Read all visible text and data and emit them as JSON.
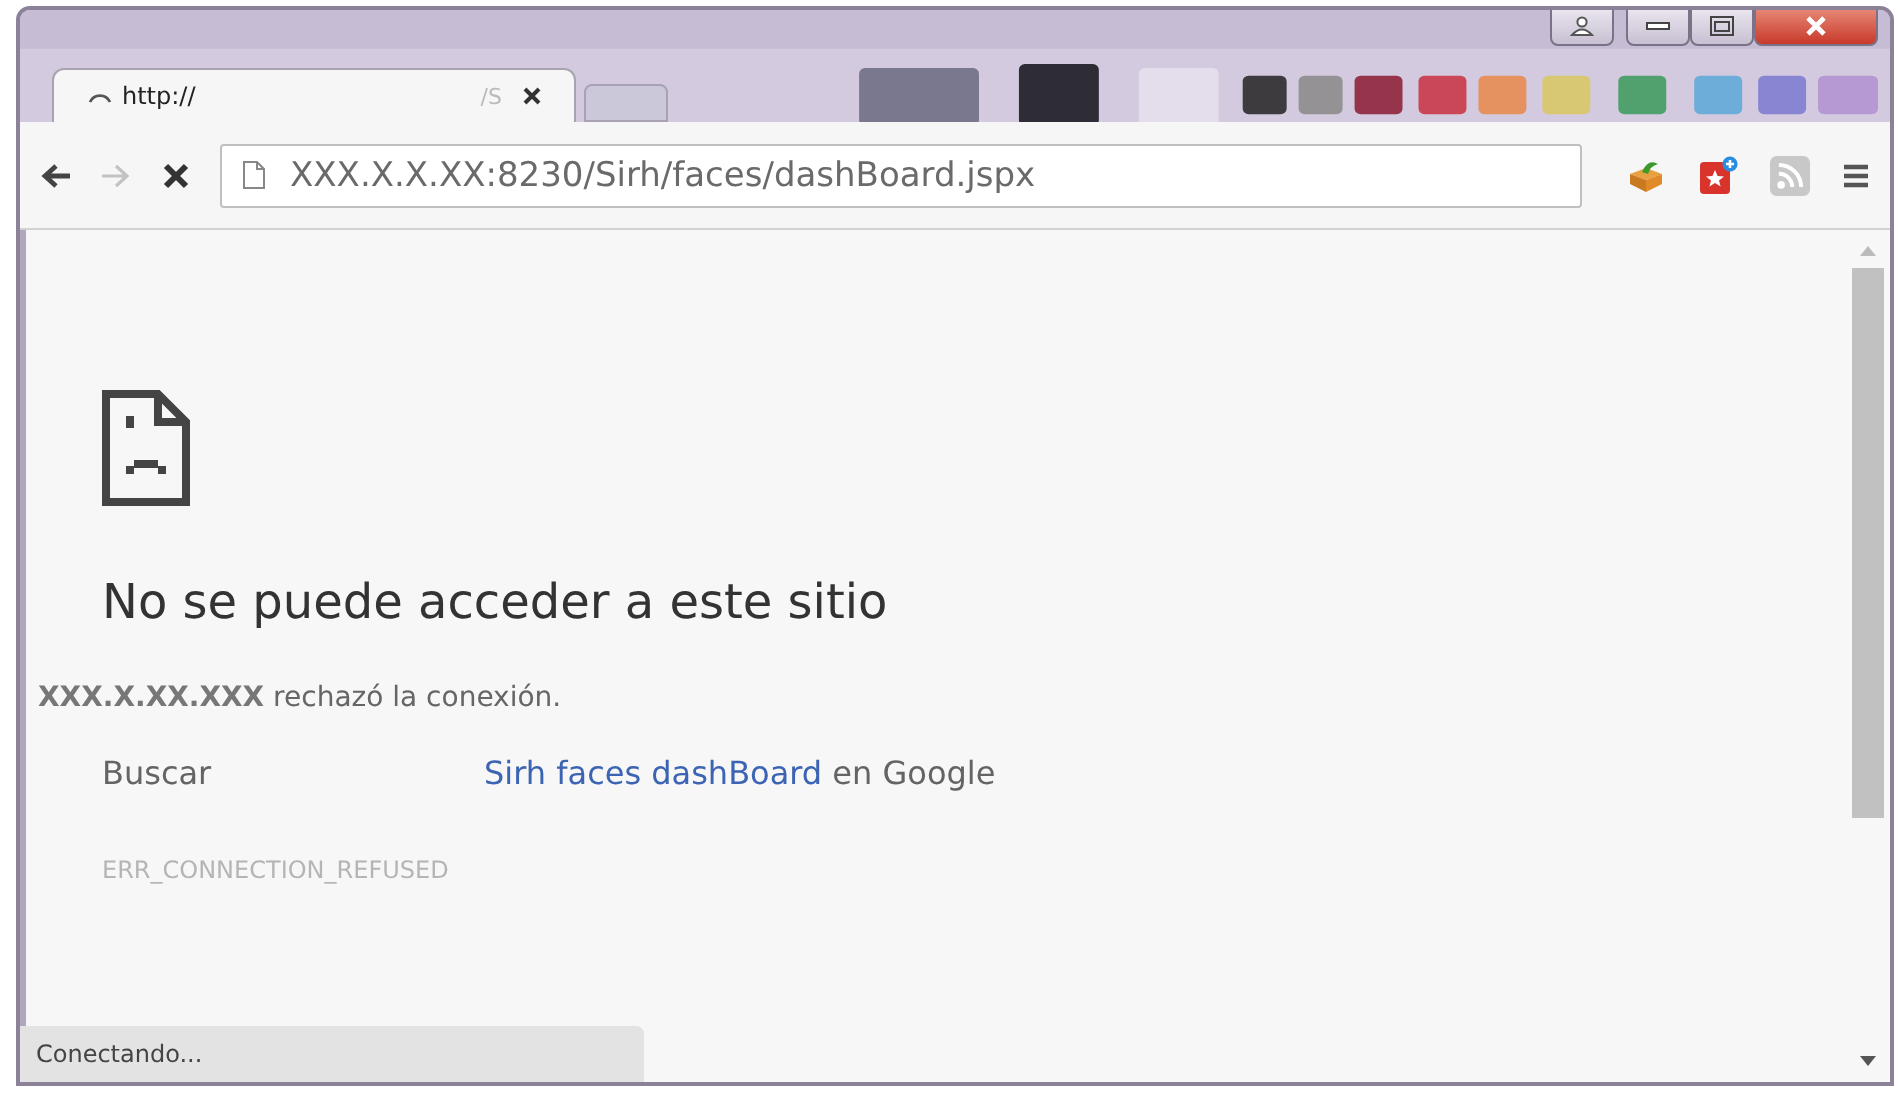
{
  "tabs": [
    {
      "title": "http://",
      "title_tail": "/S",
      "loading": true,
      "selected": true
    },
    {
      "selected": false
    }
  ],
  "toolbar": {
    "forward_disabled": true,
    "url": "XXX.X.X.XX:8230/Sirh/faces/dashBoard.jspx"
  },
  "error": {
    "heading": "No se puede acceder a este sitio",
    "message": "**XXX.X.XX.XXX** rechazó la conexión.",
    "search_label": "Buscar",
    "search_link": "Sirh faces dashBoard",
    "search_suffix": "en Google",
    "code": "ERR_CONNECTION_REFUSED"
  },
  "status_bar": "Conectando..."
}
